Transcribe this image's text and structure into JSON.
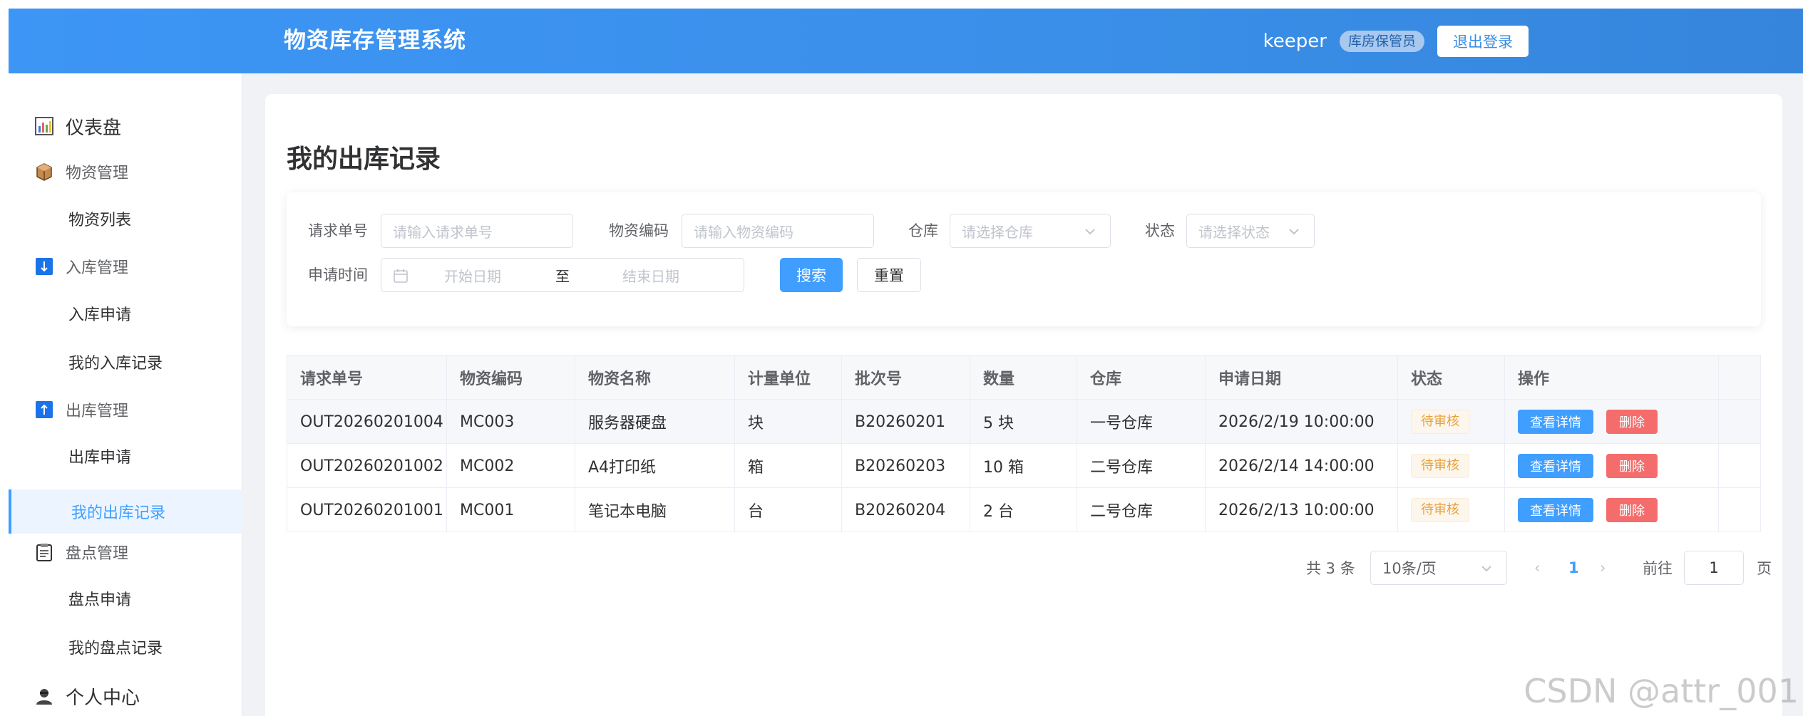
{
  "header": {
    "title": "物资库存管理系统",
    "username": "keeper",
    "role": "库房保管员",
    "logout_label": "退出登录"
  },
  "sidebar": {
    "items": [
      {
        "label": "仪表盘",
        "icon": "chart-icon"
      },
      {
        "label": "物资管理",
        "icon": "box-icon"
      },
      {
        "label": "物资列表"
      },
      {
        "label": "入库管理",
        "icon": "arrow-down-icon"
      },
      {
        "label": "入库申请"
      },
      {
        "label": "我的入库记录"
      },
      {
        "label": "出库管理",
        "icon": "arrow-up-icon"
      },
      {
        "label": "出库申请"
      },
      {
        "label": "我的出库记录"
      },
      {
        "label": "盘点管理",
        "icon": "clipboard-icon"
      },
      {
        "label": "盘点申请"
      },
      {
        "label": "我的盘点记录"
      },
      {
        "label": "个人中心",
        "icon": "user-icon"
      }
    ],
    "active_index": 8
  },
  "main": {
    "title": "我的出库记录",
    "filters": {
      "request_no_label": "请求单号",
      "request_no_placeholder": "请输入请求单号",
      "material_code_label": "物资编码",
      "material_code_placeholder": "请输入物资编码",
      "warehouse_label": "仓库",
      "warehouse_placeholder": "请选择仓库",
      "status_label": "状态",
      "status_placeholder": "请选择状态",
      "date_label": "申请时间",
      "start_placeholder": "开始日期",
      "range_separator": "至",
      "end_placeholder": "结束日期",
      "search_label": "搜索",
      "reset_label": "重置"
    },
    "table": {
      "columns": [
        "请求单号",
        "物资编码",
        "物资名称",
        "计量单位",
        "批次号",
        "数量",
        "仓库",
        "申请日期",
        "状态",
        "操作"
      ],
      "rows": [
        {
          "request_no": "OUT20260201004",
          "code": "MC003",
          "name": "服务器硬盘",
          "unit": "块",
          "batch": "B20260201",
          "qty": "5 块",
          "warehouse": "一号仓库",
          "date": "2026/2/19 10:00:00",
          "status": "待审核"
        },
        {
          "request_no": "OUT20260201002",
          "code": "MC002",
          "name": "A4打印纸",
          "unit": "箱",
          "batch": "B20260203",
          "qty": "10 箱",
          "warehouse": "二号仓库",
          "date": "2026/2/14 14:00:00",
          "status": "待审核"
        },
        {
          "request_no": "OUT20260201001",
          "code": "MC001",
          "name": "笔记本电脑",
          "unit": "台",
          "batch": "B20260204",
          "qty": "2 台",
          "warehouse": "二号仓库",
          "date": "2026/2/13 10:00:00",
          "status": "待审核"
        }
      ],
      "view_label": "查看详情",
      "delete_label": "删除"
    },
    "pagination": {
      "total": "共 3 条",
      "page_size": "10条/页",
      "prev": "‹",
      "current": "1",
      "next": "›",
      "goto_label": "前往",
      "goto_value": "1",
      "page_unit": "页"
    }
  },
  "watermark": "CSDN @attr_001",
  "colors": {
    "header_bg": "#3a8fe8",
    "primary": "#409eff",
    "danger": "#f56c6c",
    "warning": "#e6a23c"
  }
}
